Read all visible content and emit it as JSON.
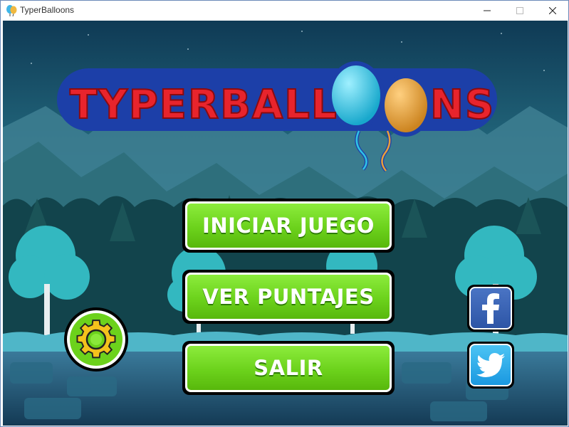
{
  "window": {
    "title": "TyperBalloons",
    "controls": {
      "minimize_icon": "minimize-icon",
      "maximize_icon": "maximize-icon",
      "close_icon": "close-icon"
    }
  },
  "logo": {
    "text_left": "TYPERBALL",
    "text_right": "NS",
    "balloon_colors": [
      "#2fc4e4",
      "#e8a03a"
    ],
    "fill_color": "#e8242c",
    "outline_color": "#1c3fa8"
  },
  "menu": {
    "start_label": "INICIAR JUEGO",
    "scores_label": "VER PUNTAJES",
    "exit_label": "SALIR"
  },
  "settings": {
    "icon": "gear-icon"
  },
  "social": {
    "facebook_icon": "facebook-icon",
    "twitter_icon": "twitter-icon"
  },
  "colors": {
    "button_green": "#6cd21c",
    "sky": "#1f5e73",
    "mountains": "#3e8a96",
    "trees": "#1e6b6e"
  }
}
